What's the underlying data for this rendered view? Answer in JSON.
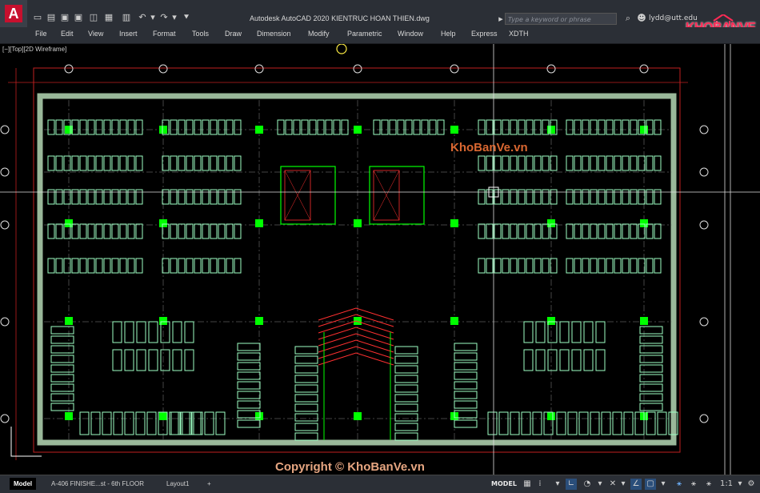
{
  "app": {
    "title": "Autodesk AutoCAD 2020    KIENTRUC HOAN THIEN.dwg",
    "search_placeholder": "Type a keyword or phrase",
    "user": "lydd@utt.edu",
    "logo_letter": "A"
  },
  "menu": [
    "File",
    "Edit",
    "View",
    "Insert",
    "Format",
    "Tools",
    "Draw",
    "Dimension",
    "Modify",
    "Parametric",
    "Window",
    "Help",
    "Express",
    "XDTH"
  ],
  "viewport": {
    "label": "[−][Top][2D Wireframe]"
  },
  "tabs": [
    "Model",
    "A-406 FINISHE...st - 6th FLOOR",
    "Layout1"
  ],
  "status": {
    "mode": "MODEL",
    "scale": "1:1"
  },
  "watermarks": {
    "logo": "KHOBANVE",
    "center": "KhoBanVe.vn",
    "copyright": "Copyright © KhoBanVe.vn"
  },
  "colors": {
    "accent_red": "#c8102e",
    "column_green": "#00ff00",
    "car_green": "#9effc4",
    "stair_red": "#ff3030"
  }
}
